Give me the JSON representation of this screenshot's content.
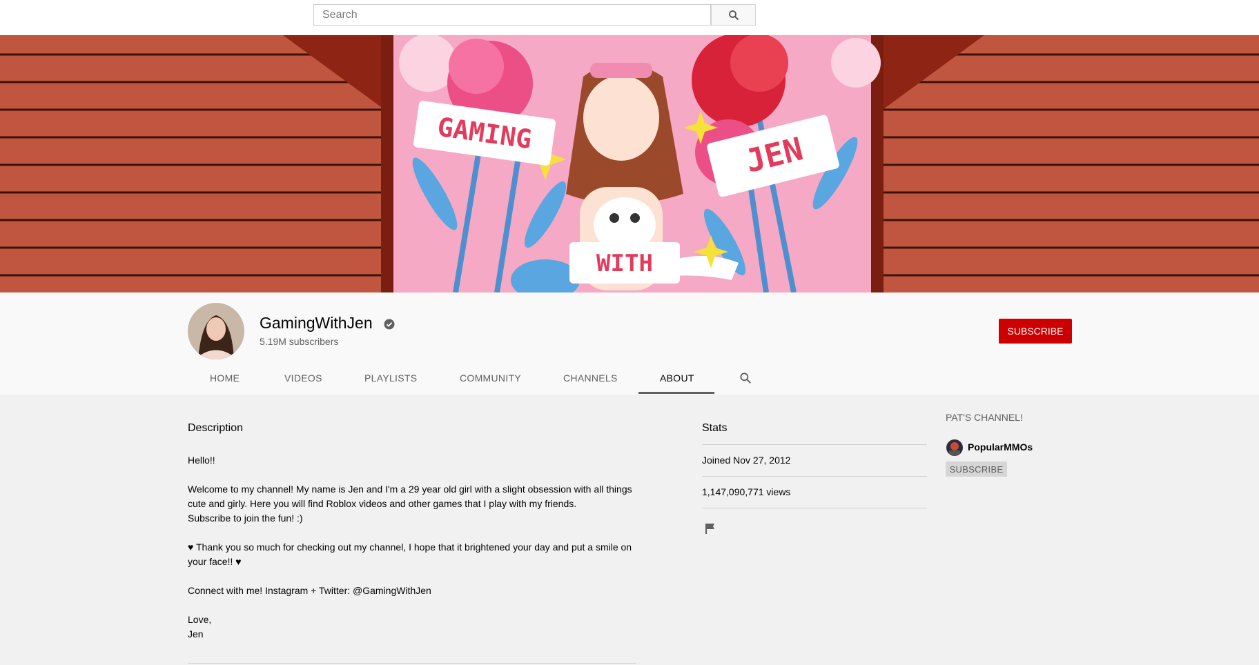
{
  "search": {
    "placeholder": "Search"
  },
  "banner": {
    "words": [
      "GAMING",
      "JEN",
      "WITH"
    ]
  },
  "channel": {
    "name": "GamingWithJen",
    "subscribers": "5.19M subscribers",
    "subscribe_label": "SUBSCRIBE"
  },
  "tabs": [
    {
      "label": "HOME"
    },
    {
      "label": "VIDEOS"
    },
    {
      "label": "PLAYLISTS"
    },
    {
      "label": "COMMUNITY"
    },
    {
      "label": "CHANNELS"
    },
    {
      "label": "ABOUT"
    }
  ],
  "about": {
    "description_title": "Description",
    "description": "Hello!!\n\nWelcome to my channel! My name is Jen and I'm a 29 year old girl with a slight obsession with all things cute and girly. Here you will find Roblox videos and other games that I play with my friends.\nSubscribe to join the fun! :)\n\n♥ Thank you so much for checking out my channel, I hope that it brightened your day and put a smile on your face!! ♥\n\nConnect with me! Instagram + Twitter: @GamingWithJen\n\nLove,\nJen",
    "stats_title": "Stats",
    "joined": "Joined Nov 27, 2012",
    "views": "1,147,090,771 views"
  },
  "featured": {
    "title": "PAT'S CHANNEL!",
    "channel_name": "PopularMMOs",
    "subscribe_label": "SUBSCRIBE"
  },
  "colors": {
    "brand_red": "#cc0000",
    "banner_wood": "#c0563f",
    "banner_pink": "#f6a9c4"
  }
}
